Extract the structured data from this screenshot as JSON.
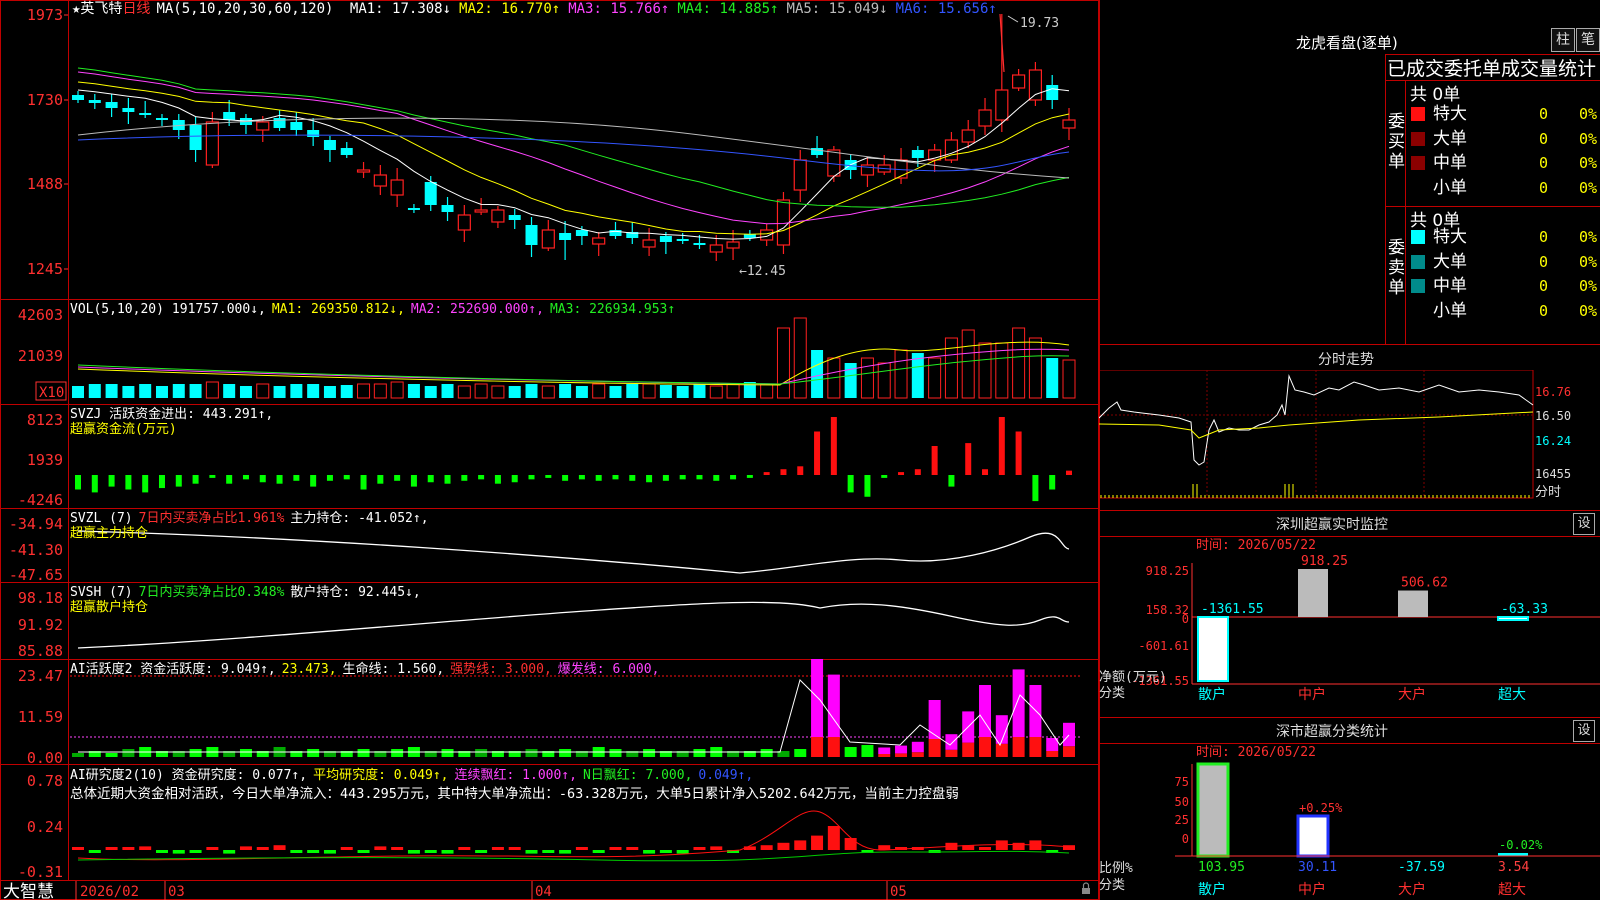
{
  "app": {
    "brand": "大智慧"
  },
  "main_chart": {
    "stock": "★英飞特",
    "period": "日线",
    "ma_title": "MA(5,10,20,30,60,120)",
    "ma": [
      {
        "label": "MA1: 17.308↓",
        "color": "#ffffff"
      },
      {
        "label": "MA2: 16.770↑",
        "color": "#ffff00"
      },
      {
        "label": "MA3: 15.766↑",
        "color": "#ff44ff"
      },
      {
        "label": "MA4: 14.885↑",
        "color": "#22ee22"
      },
      {
        "label": "MA5: 15.049↓",
        "color": "#bbbbbb"
      },
      {
        "label": "MA6: 15.656↑",
        "color": "#3355ff"
      }
    ],
    "y_ticks": [
      "1973",
      "1730",
      "1488",
      "1245"
    ],
    "high_label": "19.73",
    "low_label": "←12.45",
    "up_color": "#ff2020",
    "down_color": "#00ffff"
  },
  "vol_panel": {
    "title": "VOL(5,10,20)",
    "value": "191757.000↓,",
    "ma": [
      {
        "label": "MA1: 269350.812↓,",
        "color": "#ffff00"
      },
      {
        "label": "MA2: 252690.000↑,",
        "color": "#ff44ff"
      },
      {
        "label": "MA3: 226934.953↑",
        "color": "#22ee22"
      }
    ],
    "y_ticks": [
      "42603",
      "21039"
    ],
    "unit": "X10"
  },
  "svzj_panel": {
    "title": "SVZJ  活跃资金进出: 443.291↑,",
    "subtitle": "超赢资金流(万元)",
    "y_ticks": [
      "8123",
      "1939",
      "-4246"
    ]
  },
  "svzl_panel": {
    "title_a": "SVZL (7)",
    "title_b": "7日内买卖净占比1.961%",
    "title_c": "主力持仓: -41.052↑,",
    "subtitle": "超赢主力持仓",
    "y_ticks": [
      "-34.94",
      "-41.30",
      "-47.65"
    ]
  },
  "svsh_panel": {
    "title_a": "SVSH (7)",
    "title_b": "7日内买卖净占比0.348%",
    "title_c": "散户持仓: 92.445↓,",
    "subtitle": "超赢散户持仓",
    "y_ticks": [
      "98.18",
      "91.92",
      "85.88"
    ]
  },
  "ai_active_panel": {
    "title": "AI活跃度2 资金活跃度: 9.049↑,",
    "v2": "23.473,",
    "v3": "生命线: 1.560,",
    "v4": "强势线: 3.000,",
    "v5": "爆发线: 6.000,",
    "y_ticks": [
      "23.47",
      "11.59",
      "0.00"
    ]
  },
  "ai_research_panel": {
    "title": "AI研究度2(10) 资金研究度: 0.077↑,",
    "v2": "平均研究度: 0.049↑,",
    "v3": "连续飘红: 1.000↑,",
    "v4": "N日飘红: 7.000,",
    "v5": "0.049↑,",
    "summary": "总体近期大资金相对活跃，今日大单净流入：443.295万元，其中特大单净流出：-63.328万元，大单5日累计净入5202.642万元，当前主力控盘弱",
    "y_ticks": [
      "0.78",
      "0.24",
      "-0.31"
    ]
  },
  "x_axis": {
    "labels": [
      "2026/02",
      "03",
      "04",
      "05"
    ]
  },
  "sidebar": {
    "title": "龙虎看盘(逐单)",
    "btn_bar": "柱",
    "btn_pen": "笔",
    "subheader": "已成交委托单成交量统计",
    "buy": {
      "group": "委买单",
      "total": "共 0单",
      "rows": [
        {
          "label": "特大",
          "v1": "0",
          "v2": "0%",
          "color": "#ff1010"
        },
        {
          "label": "大单",
          "v1": "0",
          "v2": "0%",
          "color": "#8b0000"
        },
        {
          "label": "中单",
          "v1": "0",
          "v2": "0%",
          "color": "#8b0000"
        },
        {
          "label": "小单",
          "v1": "0",
          "v2": "0%",
          "color": ""
        }
      ]
    },
    "sell": {
      "group": "委卖单",
      "total": "共 0单",
      "rows": [
        {
          "label": "特大",
          "v1": "0",
          "v2": "0%",
          "color": "#00ffff"
        },
        {
          "label": "大单",
          "v1": "0",
          "v2": "0%",
          "color": "#008b8b"
        },
        {
          "label": "中单",
          "v1": "0",
          "v2": "0%",
          "color": "#008b8b"
        },
        {
          "label": "小单",
          "v1": "0",
          "v2": "0%",
          "color": ""
        }
      ]
    },
    "intraday": {
      "title": "分时走势",
      "y_ticks": [
        "16.76",
        "16.50",
        "16.24",
        "16455"
      ],
      "unit": "分时"
    },
    "monitor": {
      "title": "深圳超赢实时监控",
      "btn": "设",
      "time": "时间: 2026/05/22",
      "y_ticks": [
        "918.25",
        "158.32",
        "0",
        "-601.61",
        "-1361.55"
      ],
      "y_title": "净额(万元)",
      "x_title": "分类",
      "categories": [
        "散户",
        "中户",
        "大户",
        "超大"
      ],
      "value_labels": [
        "-1361.55",
        "918.25",
        "506.62",
        "-63.33"
      ],
      "values": [
        -1361.55,
        918.25,
        506.62,
        -63.33
      ]
    },
    "stats": {
      "title": "深市超赢分类统计",
      "btn": "设",
      "time": "时间: 2026/05/22",
      "y_ticks": [
        "75",
        "50",
        "25",
        "0"
      ],
      "y_title": "比例%",
      "x_title": "分类",
      "categories": [
        "散户",
        "中户",
        "大户",
        "超大"
      ],
      "pct_labels": [
        "+0.25%",
        "-0.02%"
      ],
      "bottom_values": [
        "103.95",
        "30.11",
        "-37.59",
        "3.54"
      ],
      "bottom_colors": [
        "#22ee22",
        "#3355ff",
        "#00ffff",
        "#ff4040"
      ]
    }
  }
}
